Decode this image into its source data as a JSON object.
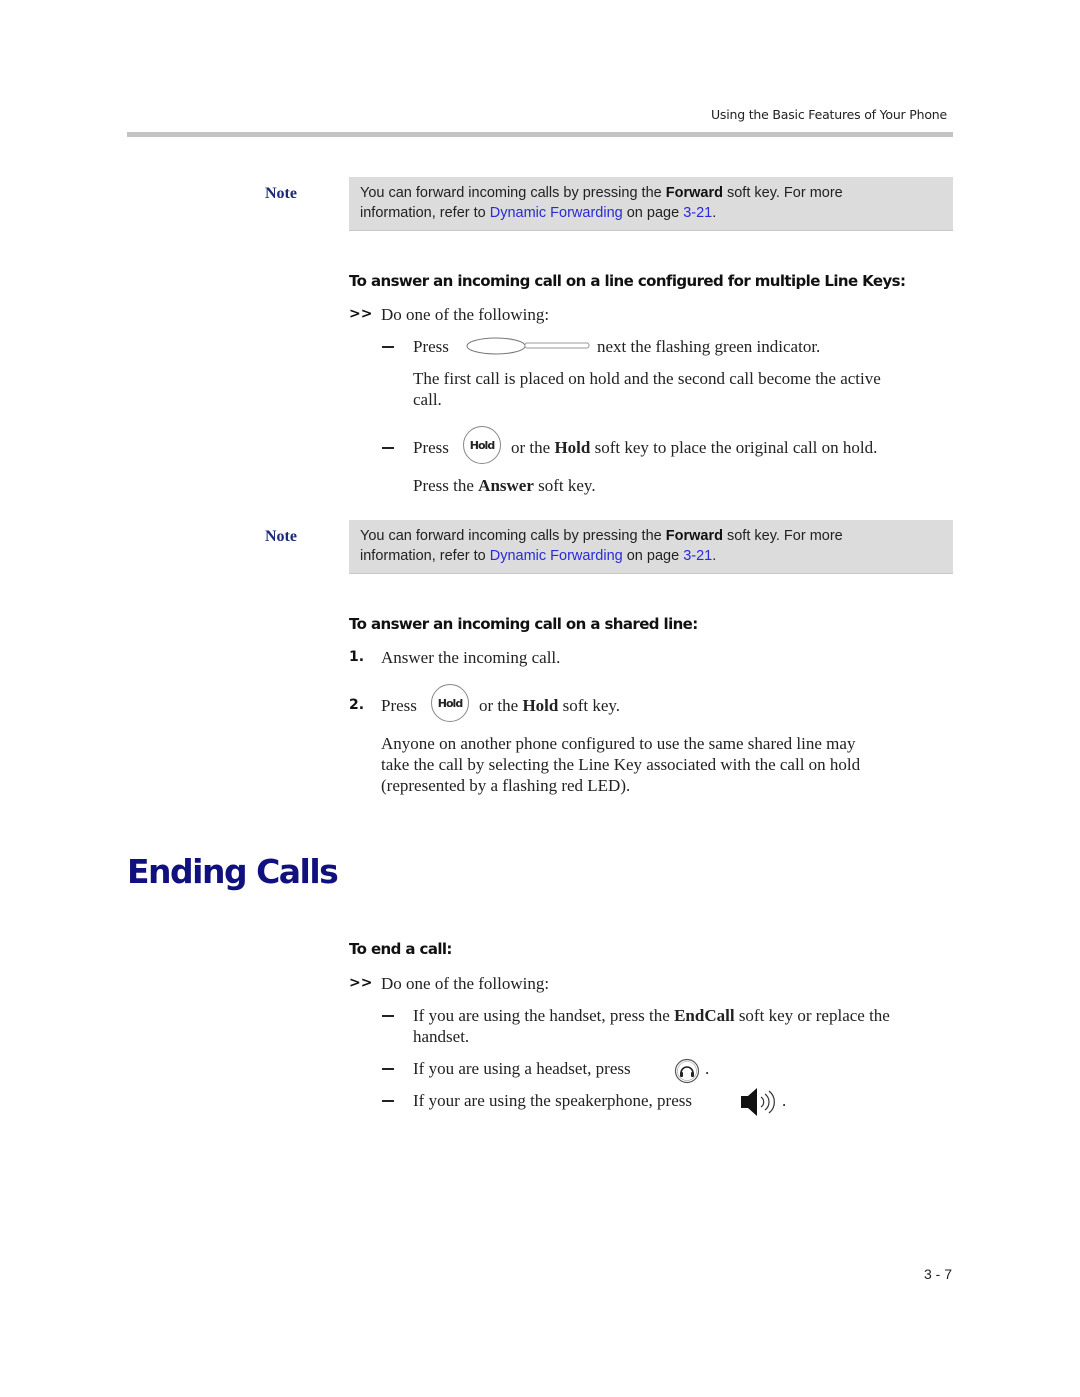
{
  "header": {
    "running_head": "Using the Basic Features of Your Phone"
  },
  "notes": [
    {
      "label": "Note",
      "text_before": "You can forward incoming calls by pressing the ",
      "bold": "Forward",
      "text_middle": " soft key. For more",
      "line2_before": "information, refer to ",
      "link_text": "Dynamic Forwarding",
      "line2_middle": " on page ",
      "page_link": "3-21",
      "line2_end": "."
    },
    {
      "label": "Note",
      "text_before": "You can forward incoming calls by pressing the ",
      "bold": "Forward",
      "text_middle": " soft key. For more",
      "line2_before": "information, refer to ",
      "link_text": "Dynamic Forwarding",
      "line2_middle": " on page ",
      "page_link": "3-21",
      "line2_end": "."
    }
  ],
  "section_multiple_line_keys": {
    "heading": "To answer an incoming call on a line configured for multiple Line Keys:",
    "marker": ">>",
    "intro": "Do one of the following:",
    "option1": {
      "press": "Press",
      "after": "next the flashing green indicator.",
      "result_line1": "The first call is placed on hold and the second call become the active",
      "result_line2": "call."
    },
    "option2": {
      "press": "Press",
      "key_label": "Hold",
      "after_before": "or the ",
      "after_bold": "Hold",
      "after_end": " soft key to place the original call on hold.",
      "next_before": "Press the ",
      "next_bold": "Answer",
      "next_end": " soft key."
    }
  },
  "section_shared_line": {
    "heading": "To answer an incoming call on a shared line:",
    "steps": [
      {
        "num": "1.",
        "text": "Answer the incoming call."
      },
      {
        "num": "2.",
        "press": "Press",
        "key_label": "Hold",
        "after_before": "or the ",
        "after_bold": "Hold",
        "after_end": " soft key."
      }
    ],
    "para_line1": "Anyone on another phone configured to use the same shared line may",
    "para_line2": "take the call by selecting the Line Key associated with the call on hold",
    "para_line3": "(represented by a flashing red LED)."
  },
  "chapter": {
    "title": "Ending Calls"
  },
  "section_end_call": {
    "heading": "To end a call:",
    "marker": ">>",
    "intro": "Do one of the following:",
    "option1_before": "If you are using the handset, press the ",
    "option1_bold": "EndCall",
    "option1_end": " soft key or replace the",
    "option1_line2": "handset.",
    "option2": "If you are using a headset, press",
    "option2_end": ".",
    "option3": "If your are using the speakerphone, press",
    "option3_end": "."
  },
  "footer": {
    "page_number": "3 - 7"
  }
}
